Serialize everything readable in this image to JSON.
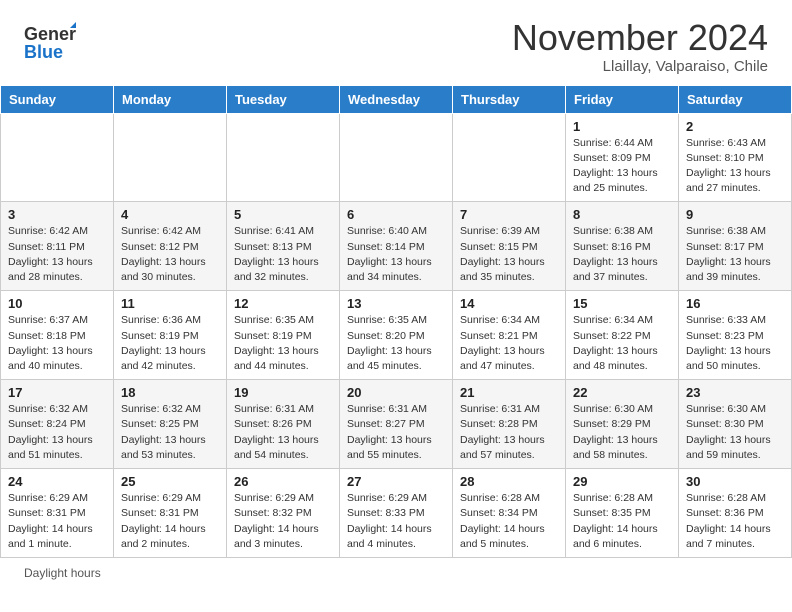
{
  "header": {
    "logo_line1": "General",
    "logo_line2": "Blue",
    "month_title": "November 2024",
    "location": "Llaillay, Valparaiso, Chile"
  },
  "days_of_week": [
    "Sunday",
    "Monday",
    "Tuesday",
    "Wednesday",
    "Thursday",
    "Friday",
    "Saturday"
  ],
  "weeks": [
    [
      {
        "day": "",
        "sunrise": "",
        "sunset": "",
        "daylight": ""
      },
      {
        "day": "",
        "sunrise": "",
        "sunset": "",
        "daylight": ""
      },
      {
        "day": "",
        "sunrise": "",
        "sunset": "",
        "daylight": ""
      },
      {
        "day": "",
        "sunrise": "",
        "sunset": "",
        "daylight": ""
      },
      {
        "day": "",
        "sunrise": "",
        "sunset": "",
        "daylight": ""
      },
      {
        "day": "1",
        "sunrise": "Sunrise: 6:44 AM",
        "sunset": "Sunset: 8:09 PM",
        "daylight": "Daylight: 13 hours and 25 minutes."
      },
      {
        "day": "2",
        "sunrise": "Sunrise: 6:43 AM",
        "sunset": "Sunset: 8:10 PM",
        "daylight": "Daylight: 13 hours and 27 minutes."
      }
    ],
    [
      {
        "day": "3",
        "sunrise": "Sunrise: 6:42 AM",
        "sunset": "Sunset: 8:11 PM",
        "daylight": "Daylight: 13 hours and 28 minutes."
      },
      {
        "day": "4",
        "sunrise": "Sunrise: 6:42 AM",
        "sunset": "Sunset: 8:12 PM",
        "daylight": "Daylight: 13 hours and 30 minutes."
      },
      {
        "day": "5",
        "sunrise": "Sunrise: 6:41 AM",
        "sunset": "Sunset: 8:13 PM",
        "daylight": "Daylight: 13 hours and 32 minutes."
      },
      {
        "day": "6",
        "sunrise": "Sunrise: 6:40 AM",
        "sunset": "Sunset: 8:14 PM",
        "daylight": "Daylight: 13 hours and 34 minutes."
      },
      {
        "day": "7",
        "sunrise": "Sunrise: 6:39 AM",
        "sunset": "Sunset: 8:15 PM",
        "daylight": "Daylight: 13 hours and 35 minutes."
      },
      {
        "day": "8",
        "sunrise": "Sunrise: 6:38 AM",
        "sunset": "Sunset: 8:16 PM",
        "daylight": "Daylight: 13 hours and 37 minutes."
      },
      {
        "day": "9",
        "sunrise": "Sunrise: 6:38 AM",
        "sunset": "Sunset: 8:17 PM",
        "daylight": "Daylight: 13 hours and 39 minutes."
      }
    ],
    [
      {
        "day": "10",
        "sunrise": "Sunrise: 6:37 AM",
        "sunset": "Sunset: 8:18 PM",
        "daylight": "Daylight: 13 hours and 40 minutes."
      },
      {
        "day": "11",
        "sunrise": "Sunrise: 6:36 AM",
        "sunset": "Sunset: 8:19 PM",
        "daylight": "Daylight: 13 hours and 42 minutes."
      },
      {
        "day": "12",
        "sunrise": "Sunrise: 6:35 AM",
        "sunset": "Sunset: 8:19 PM",
        "daylight": "Daylight: 13 hours and 44 minutes."
      },
      {
        "day": "13",
        "sunrise": "Sunrise: 6:35 AM",
        "sunset": "Sunset: 8:20 PM",
        "daylight": "Daylight: 13 hours and 45 minutes."
      },
      {
        "day": "14",
        "sunrise": "Sunrise: 6:34 AM",
        "sunset": "Sunset: 8:21 PM",
        "daylight": "Daylight: 13 hours and 47 minutes."
      },
      {
        "day": "15",
        "sunrise": "Sunrise: 6:34 AM",
        "sunset": "Sunset: 8:22 PM",
        "daylight": "Daylight: 13 hours and 48 minutes."
      },
      {
        "day": "16",
        "sunrise": "Sunrise: 6:33 AM",
        "sunset": "Sunset: 8:23 PM",
        "daylight": "Daylight: 13 hours and 50 minutes."
      }
    ],
    [
      {
        "day": "17",
        "sunrise": "Sunrise: 6:32 AM",
        "sunset": "Sunset: 8:24 PM",
        "daylight": "Daylight: 13 hours and 51 minutes."
      },
      {
        "day": "18",
        "sunrise": "Sunrise: 6:32 AM",
        "sunset": "Sunset: 8:25 PM",
        "daylight": "Daylight: 13 hours and 53 minutes."
      },
      {
        "day": "19",
        "sunrise": "Sunrise: 6:31 AM",
        "sunset": "Sunset: 8:26 PM",
        "daylight": "Daylight: 13 hours and 54 minutes."
      },
      {
        "day": "20",
        "sunrise": "Sunrise: 6:31 AM",
        "sunset": "Sunset: 8:27 PM",
        "daylight": "Daylight: 13 hours and 55 minutes."
      },
      {
        "day": "21",
        "sunrise": "Sunrise: 6:31 AM",
        "sunset": "Sunset: 8:28 PM",
        "daylight": "Daylight: 13 hours and 57 minutes."
      },
      {
        "day": "22",
        "sunrise": "Sunrise: 6:30 AM",
        "sunset": "Sunset: 8:29 PM",
        "daylight": "Daylight: 13 hours and 58 minutes."
      },
      {
        "day": "23",
        "sunrise": "Sunrise: 6:30 AM",
        "sunset": "Sunset: 8:30 PM",
        "daylight": "Daylight: 13 hours and 59 minutes."
      }
    ],
    [
      {
        "day": "24",
        "sunrise": "Sunrise: 6:29 AM",
        "sunset": "Sunset: 8:31 PM",
        "daylight": "Daylight: 14 hours and 1 minute."
      },
      {
        "day": "25",
        "sunrise": "Sunrise: 6:29 AM",
        "sunset": "Sunset: 8:31 PM",
        "daylight": "Daylight: 14 hours and 2 minutes."
      },
      {
        "day": "26",
        "sunrise": "Sunrise: 6:29 AM",
        "sunset": "Sunset: 8:32 PM",
        "daylight": "Daylight: 14 hours and 3 minutes."
      },
      {
        "day": "27",
        "sunrise": "Sunrise: 6:29 AM",
        "sunset": "Sunset: 8:33 PM",
        "daylight": "Daylight: 14 hours and 4 minutes."
      },
      {
        "day": "28",
        "sunrise": "Sunrise: 6:28 AM",
        "sunset": "Sunset: 8:34 PM",
        "daylight": "Daylight: 14 hours and 5 minutes."
      },
      {
        "day": "29",
        "sunrise": "Sunrise: 6:28 AM",
        "sunset": "Sunset: 8:35 PM",
        "daylight": "Daylight: 14 hours and 6 minutes."
      },
      {
        "day": "30",
        "sunrise": "Sunrise: 6:28 AM",
        "sunset": "Sunset: 8:36 PM",
        "daylight": "Daylight: 14 hours and 7 minutes."
      }
    ]
  ],
  "footer": {
    "daylight_label": "Daylight hours"
  }
}
